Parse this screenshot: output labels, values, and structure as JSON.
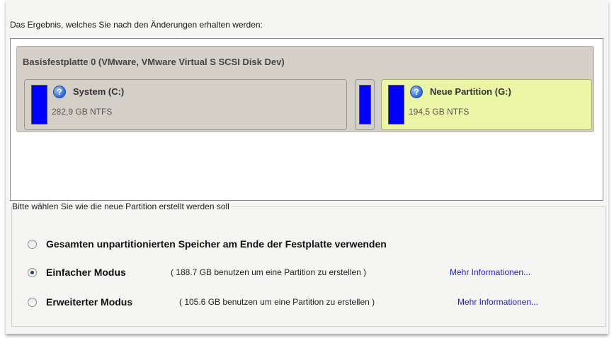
{
  "result_label": "Das Ergebnis, welches Sie nach den Änderungen erhalten werden:",
  "disk": {
    "title": "Basisfestplatte 0 (VMware, VMware Virtual S SCSI Disk Dev)",
    "partitions": [
      {
        "name": "System (C:)",
        "info": "282,9 GB NTFS"
      },
      {
        "name": "Neue Partition (G:)",
        "info": "194,5 GB NTFS"
      }
    ]
  },
  "colors": {
    "partition_bar": "#0000ff",
    "new_partition_bg": "#eaf5a6",
    "link": "#2222cc"
  },
  "options": {
    "legend": "Bitte wählen Sie wie die neue Partition erstellt werden soll",
    "items": [
      {
        "label": "Gesamten unpartitionierten Speicher am Ende der Festplatte verwenden",
        "desc": "",
        "link": "",
        "checked": false
      },
      {
        "label": "Einfacher Modus",
        "desc": "( 188.7 GB benutzen um eine Partition zu erstellen )",
        "link": "Mehr Informationen...",
        "checked": true
      },
      {
        "label": "Erweiterter Modus",
        "desc": "( 105.6 GB benutzen um eine Partition zu erstellen )",
        "link": "Mehr Informationen...",
        "checked": false
      }
    ]
  }
}
